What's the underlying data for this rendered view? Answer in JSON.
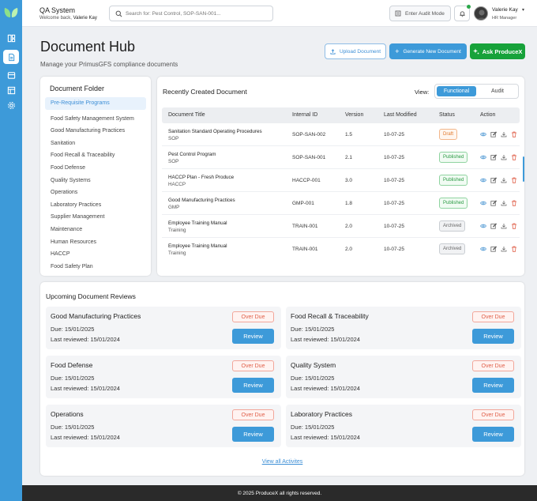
{
  "topbar": {
    "app_title": "QA System",
    "welcome_prefix": "Welcome back,",
    "welcome_name": "Valerie Kay",
    "search_placeholder": "Search for: Pest Control, SOP-SAN-001...",
    "audit_mode_label": "Enter Audit Mode",
    "user_name": "Valerie Kay",
    "user_role": "HR Manager"
  },
  "page": {
    "title": "Document Hub",
    "subtitle": "Manage your PrimusGFS compliance documents",
    "upload_label": "Upload Document",
    "generate_label": "Generate New Document",
    "ask_label": "Ask ProduceX"
  },
  "folder": {
    "title": "Document Folder",
    "items": [
      "Pre-Requisite Programs",
      "Food Safety Management System",
      "Good Manufacturing Practices",
      "Sanitation",
      "Food Recall & Traceability",
      "Food Defense",
      "Quality Systems",
      "Operations",
      "Laboratory Practices",
      "Supplier Management",
      "Maintenance",
      "Human Resources",
      "HACCP",
      "Food Safety Plan"
    ]
  },
  "documents": {
    "title": "Recently Created Document",
    "view_label": "View:",
    "view_options": [
      "Functional",
      "Audit"
    ],
    "columns": [
      "Document Title",
      "Internal ID",
      "Version",
      "Last Modified",
      "Status",
      "Action"
    ],
    "rows": [
      {
        "title": "Sanitation Standard Operating Procedures",
        "category": "SOP",
        "id": "SOP-SAN-002",
        "version": "1.5",
        "modified": "10-07-25",
        "status": "Draft"
      },
      {
        "title": "Pest Control Program",
        "category": "SOP",
        "id": "SOP-SAN-001",
        "version": "2.1",
        "modified": "10-07-25",
        "status": "Published"
      },
      {
        "title": "HACCP Plan - Fresh Produce",
        "category": "HACCP",
        "id": "HACCP-001",
        "version": "3.0",
        "modified": "10-07-25",
        "status": "Published"
      },
      {
        "title": "Good Manufacturing Practices",
        "category": "GMP",
        "id": "GMP-001",
        "version": "1.8",
        "modified": "10-07-25",
        "status": "Published"
      },
      {
        "title": "Employee Training Manual",
        "category": "Training",
        "id": "TRAIN-001",
        "version": "2.0",
        "modified": "10-07-25",
        "status": "Archived"
      },
      {
        "title": "Employee Training Manual",
        "category": "Training",
        "id": "TRAIN-001",
        "version": "2.0",
        "modified": "10-07-25",
        "status": "Archived"
      }
    ]
  },
  "reviews": {
    "title": "Upcoming Document Reviews",
    "overdue_label": "Over Due",
    "review_label": "Review",
    "items": [
      {
        "name": "Good Manufacturing Practices",
        "due": "Due: 15/01/2025",
        "last": "Last reviewed: 15/01/2024"
      },
      {
        "name": "Food Recall & Traceability",
        "due": "Due: 15/01/2025",
        "last": "Last reviewed: 15/01/2024"
      },
      {
        "name": "Food Defense",
        "due": "Due: 15/01/2025",
        "last": "Last reviewed: 15/01/2024"
      },
      {
        "name": "Quality System",
        "due": "Due: 15/01/2025",
        "last": "Last reviewed: 15/01/2024"
      },
      {
        "name": "Operations",
        "due": "Due: 15/01/2025",
        "last": "Last reviewed: 15/01/2024"
      },
      {
        "name": "Laboratory Practices",
        "due": "Due: 15/01/2025",
        "last": "Last reviewed: 15/01/2024"
      }
    ],
    "view_all": "View all Activites"
  },
  "footer": {
    "text": "© 2025 ProduceX all rights reserved."
  },
  "colors": {
    "primary": "#3d9ad9",
    "ask_green": "#17a23a",
    "draft": "#e0782b",
    "published": "#2a9a44",
    "overdue": "#e0604a"
  }
}
